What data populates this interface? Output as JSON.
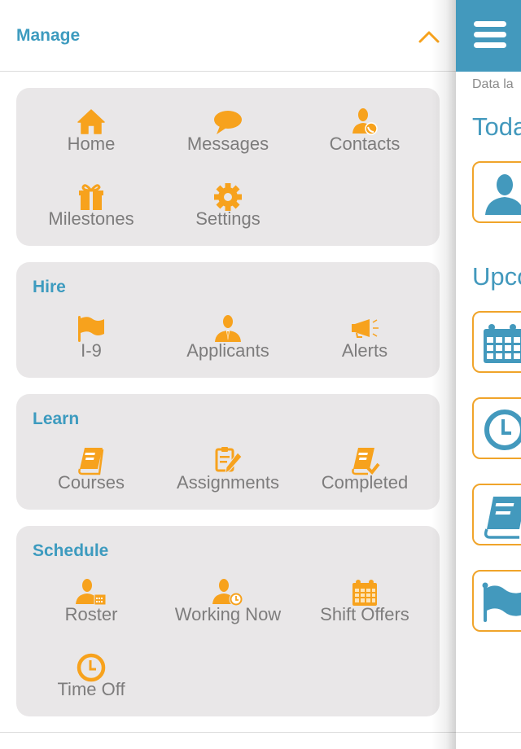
{
  "drawer": {
    "title": "Manage",
    "collapse_icon": "chevron-up-icon",
    "sections": [
      {
        "id": "manage",
        "title": "",
        "items": [
          {
            "label": "Home",
            "icon": "home-icon"
          },
          {
            "label": "Messages",
            "icon": "speech-bubble-icon"
          },
          {
            "label": "Contacts",
            "icon": "contact-phone-icon"
          },
          {
            "label": "Milestones",
            "icon": "gift-icon"
          },
          {
            "label": "Settings",
            "icon": "gear-icon"
          }
        ]
      },
      {
        "id": "hire",
        "title": "Hire",
        "items": [
          {
            "label": "I-9",
            "icon": "flag-icon"
          },
          {
            "label": "Applicants",
            "icon": "applicant-icon"
          },
          {
            "label": "Alerts",
            "icon": "megaphone-icon"
          }
        ]
      },
      {
        "id": "learn",
        "title": "Learn",
        "items": [
          {
            "label": "Courses",
            "icon": "book-icon"
          },
          {
            "label": "Assignments",
            "icon": "clipboard-pencil-icon"
          },
          {
            "label": "Completed",
            "icon": "book-check-icon"
          }
        ]
      },
      {
        "id": "schedule",
        "title": "Schedule",
        "items": [
          {
            "label": "Roster",
            "icon": "person-calendar-icon"
          },
          {
            "label": "Working Now",
            "icon": "person-clock-icon"
          },
          {
            "label": "Shift Offers",
            "icon": "calendar-icon"
          },
          {
            "label": "Time Off",
            "icon": "clock-icon"
          }
        ]
      }
    ]
  },
  "main": {
    "menu_icon": "hamburger-menu-icon",
    "data_note": "Data la",
    "today_heading": "Toda",
    "upcoming_heading": "Upco",
    "today_items": [
      {
        "icon": "person-icon"
      }
    ],
    "upcoming_items": [
      {
        "icon": "calendar-icon"
      },
      {
        "icon": "clock-icon"
      },
      {
        "icon": "book-icon"
      },
      {
        "icon": "flag-icon"
      }
    ]
  },
  "colors": {
    "accent_blue": "#4399bd",
    "accent_orange": "#f7a21d",
    "card_bg": "#e9e7e8",
    "label_gray": "#7d7c7c"
  }
}
